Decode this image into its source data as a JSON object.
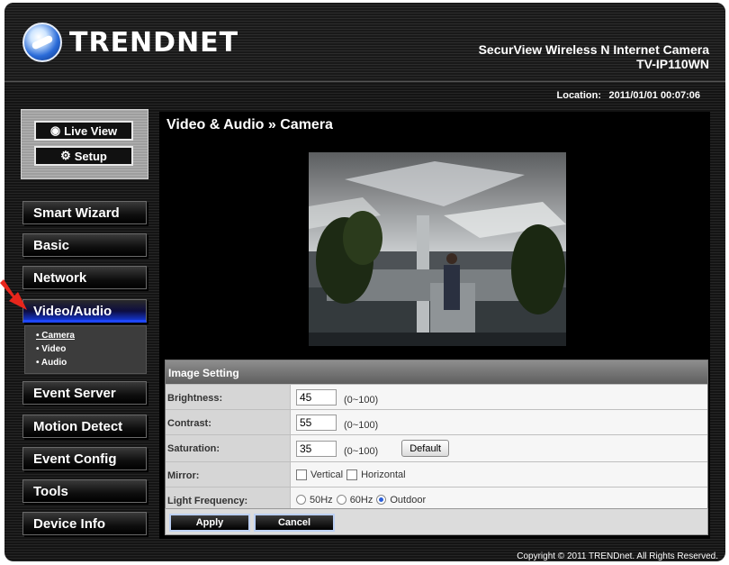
{
  "header": {
    "brand": "TRENDNET",
    "product_line1": "SecurView Wireless N Internet Camera",
    "product_line2": "TV-IP110WN"
  },
  "location": {
    "label": "Location:",
    "value": "2011/01/01 00:07:06"
  },
  "sidebar": {
    "live_view": "Live View",
    "setup": "Setup",
    "menu": [
      {
        "label": "Smart Wizard"
      },
      {
        "label": "Basic"
      },
      {
        "label": "Network"
      },
      {
        "label": "Video/Audio",
        "active": true
      },
      {
        "label": "Event Server"
      },
      {
        "label": "Motion Detect"
      },
      {
        "label": "Event Config"
      },
      {
        "label": "Tools"
      },
      {
        "label": "Device Info"
      }
    ],
    "submenu": [
      "• Camera",
      "• Video",
      "• Audio"
    ]
  },
  "main": {
    "title": "Video & Audio » Camera",
    "image_setting": {
      "heading": "Image Setting",
      "brightness": {
        "label": "Brightness:",
        "value": "45",
        "range": "(0~100)"
      },
      "contrast": {
        "label": "Contrast:",
        "value": "55",
        "range": "(0~100)"
      },
      "saturation": {
        "label": "Saturation:",
        "value": "35",
        "range": "(0~100)"
      },
      "default_btn": "Default",
      "mirror": {
        "label": "Mirror:",
        "vertical": "Vertical",
        "horizontal": "Horizontal"
      },
      "light_frequency": {
        "label": "Light Frequency:",
        "opt1": "50Hz",
        "opt2": "60Hz",
        "opt3": "Outdoor",
        "selected": "Outdoor"
      }
    },
    "apply": "Apply",
    "cancel": "Cancel"
  },
  "footer": {
    "copyright": "Copyright © 2011 TRENDnet. All Rights Reserved."
  },
  "colors": {
    "active_menu_accent": "#1e47ff",
    "pointer_arrow": "#e8261c"
  }
}
